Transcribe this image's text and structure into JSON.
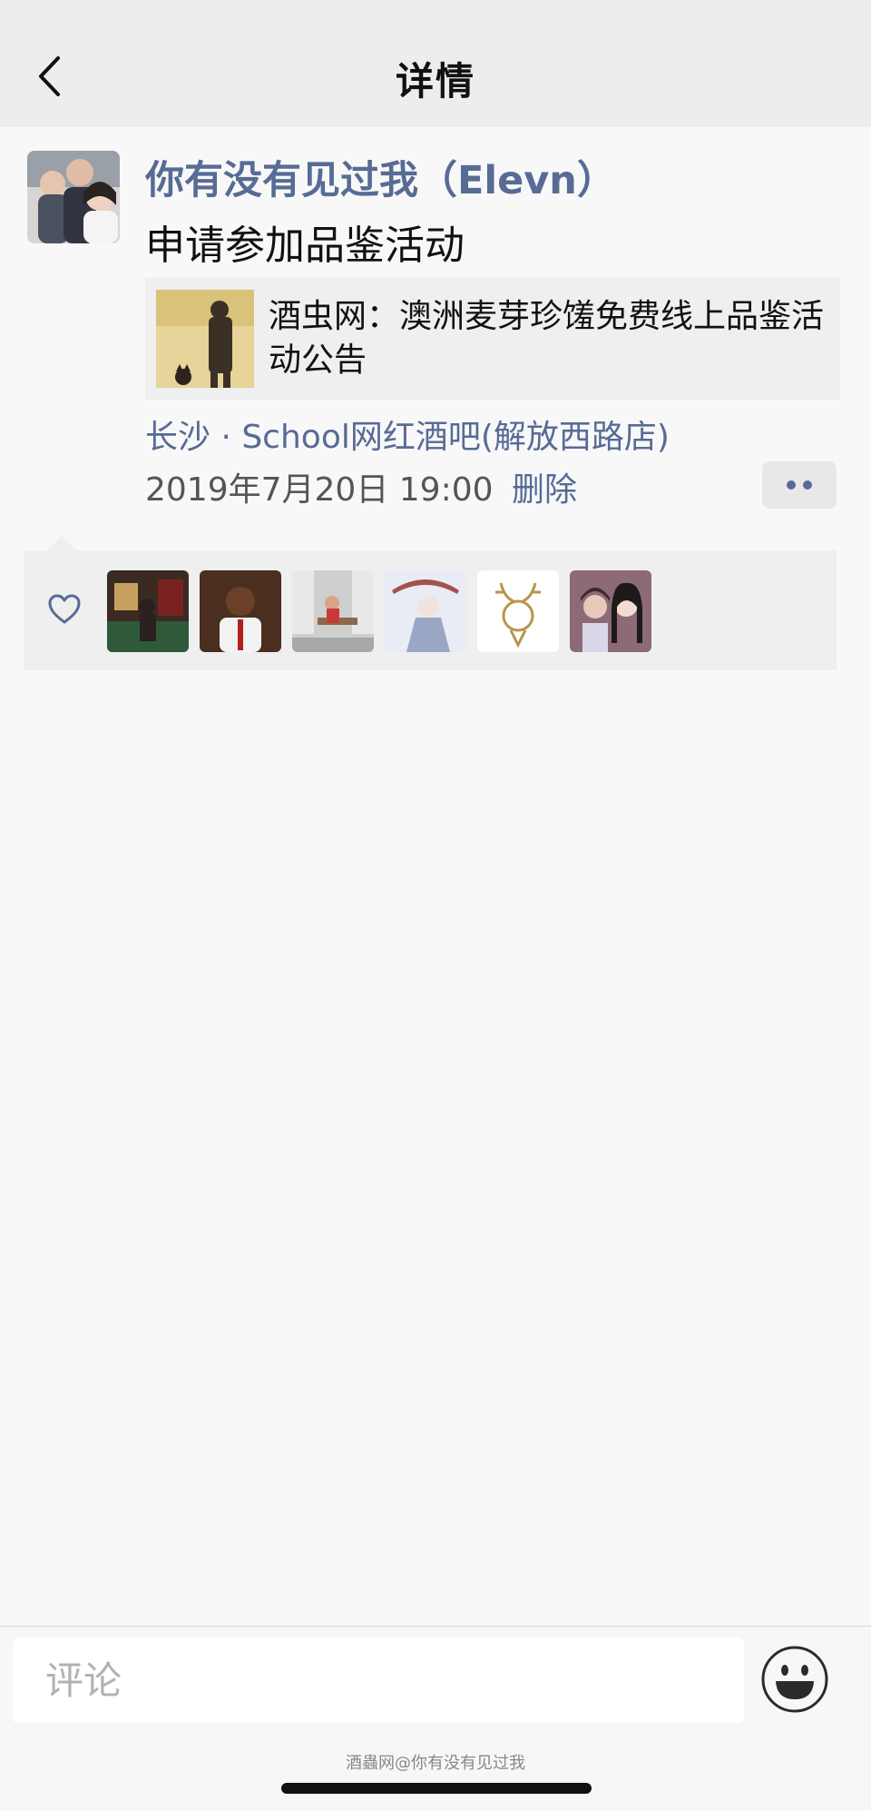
{
  "header": {
    "title": "详情"
  },
  "post": {
    "username": "你有没有见过我（Elevn）",
    "text": "申请参加品鉴活动",
    "link": {
      "title": "酒虫网：澳洲麦芽珍馐免费线上品鉴活动公告"
    },
    "location": "长沙 · School网红酒吧(解放西路店)",
    "time": "2019年7月20日 19:00",
    "delete_label": "删除"
  },
  "likes": {
    "count": 6
  },
  "comment": {
    "placeholder": "评论"
  },
  "watermark": "酒蟲网@你有没有见过我",
  "colors": {
    "link_blue": "#576b95",
    "header_bg": "#ededed",
    "page_bg": "#f8f8f8",
    "panel_bg": "#efefef"
  }
}
